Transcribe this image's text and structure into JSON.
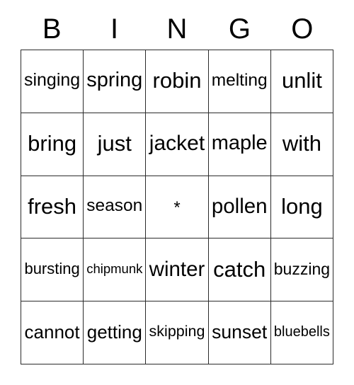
{
  "card": {
    "header_letters": [
      "B",
      "I",
      "N",
      "G",
      "O"
    ],
    "free_space_marker": "*",
    "grid_rows": [
      [
        "singing",
        "spring",
        "robin",
        "melting",
        "unlit"
      ],
      [
        "bring",
        "just",
        "jacket",
        "maple",
        "with"
      ],
      [
        "fresh",
        "season",
        "*",
        "pollen",
        "long"
      ],
      [
        "bursting",
        "chipmunk",
        "winter",
        "catch",
        "buzzing"
      ],
      [
        "cannot",
        "getting",
        "skipping",
        "sunset",
        "bluebells"
      ]
    ],
    "colors": {
      "background": "#ffffff",
      "text": "#000000",
      "grid_line": "#2b2b2b"
    }
  }
}
